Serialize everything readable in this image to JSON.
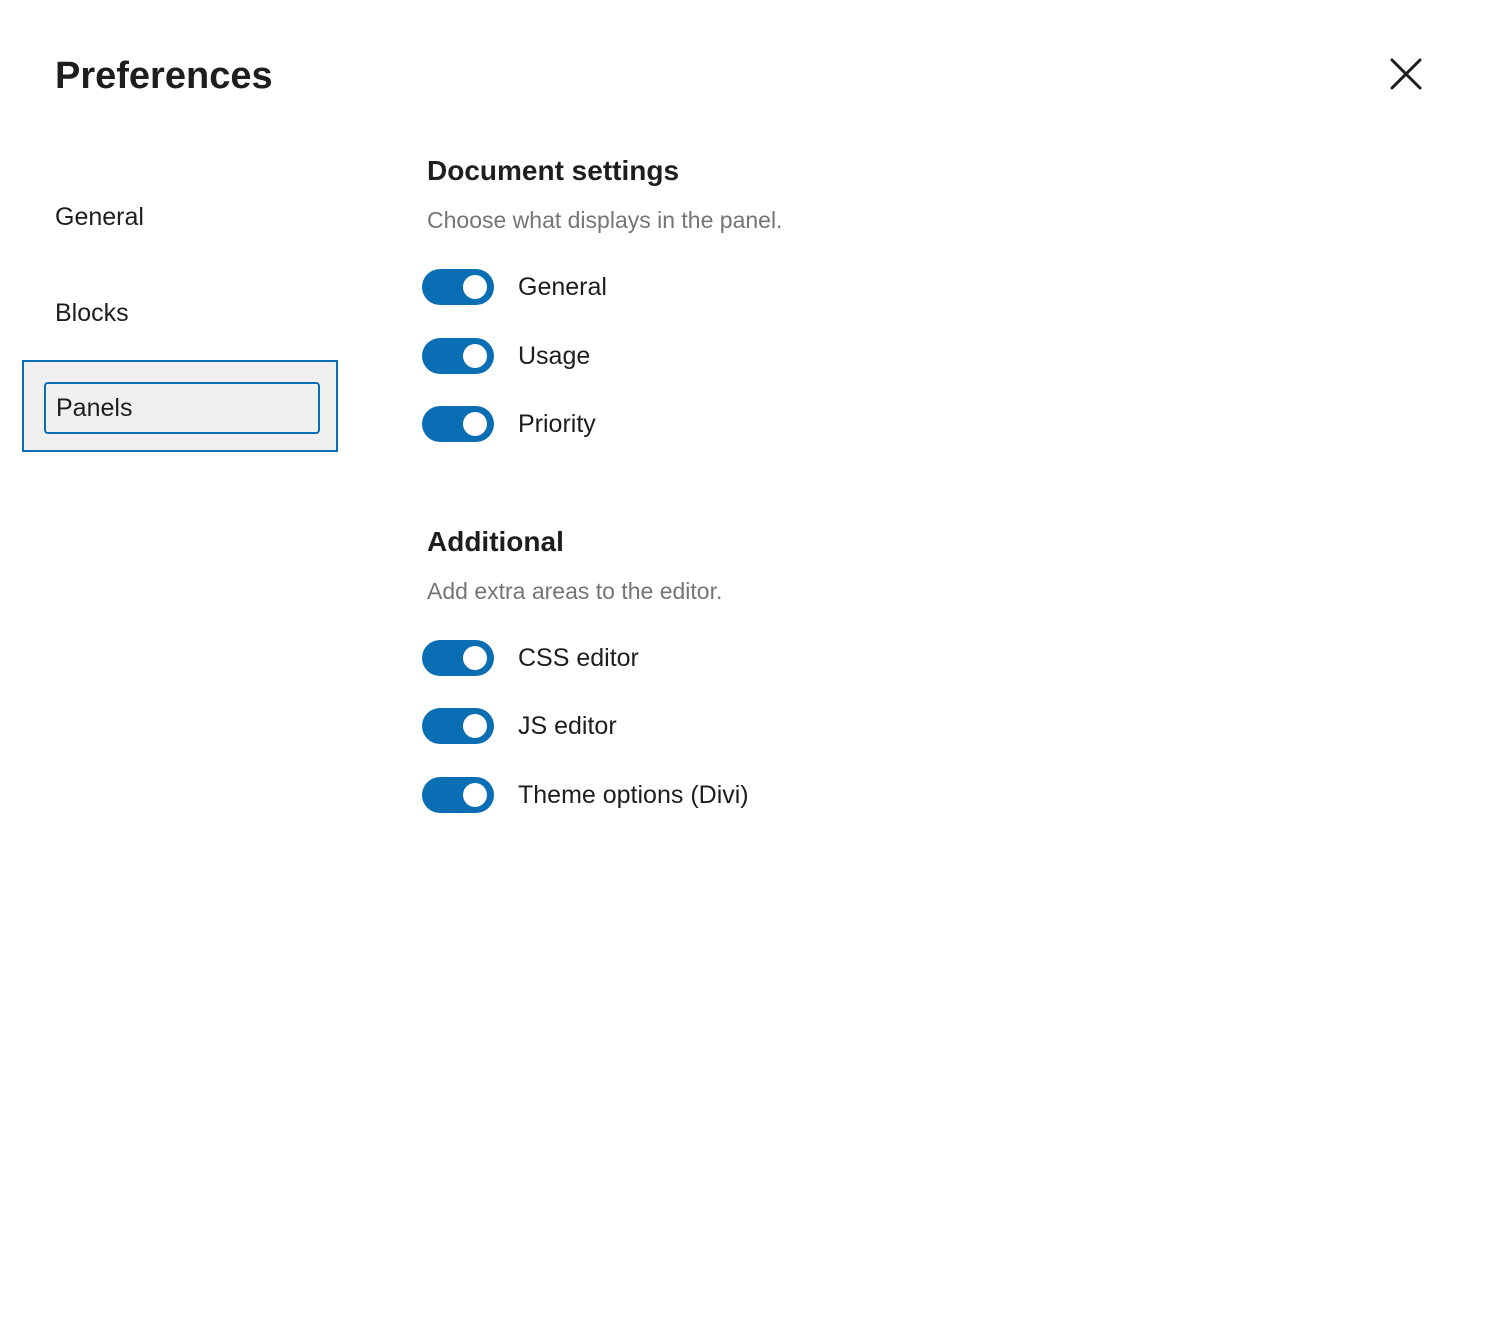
{
  "modal": {
    "title": "Preferences",
    "close_icon": "close-icon"
  },
  "sidebar": {
    "items": [
      {
        "label": "General",
        "active": false
      },
      {
        "label": "Blocks",
        "active": false
      },
      {
        "label": "Panels",
        "active": true
      }
    ]
  },
  "content": {
    "sections": [
      {
        "title": "Document settings",
        "description": "Choose what displays in the panel.",
        "toggles": [
          {
            "label": "General",
            "checked": true
          },
          {
            "label": "Usage",
            "checked": true
          },
          {
            "label": "Priority",
            "checked": true
          }
        ]
      },
      {
        "title": "Additional",
        "description": "Add extra areas to the editor.",
        "toggles": [
          {
            "label": "CSS editor",
            "checked": true
          },
          {
            "label": "JS editor",
            "checked": true
          },
          {
            "label": "Theme options (Divi)",
            "checked": true
          }
        ]
      }
    ]
  },
  "colors": {
    "accent": "#0a6eb4",
    "text": "#1e1e1e",
    "muted_text": "#757575",
    "active_nav_bg": "#f0f0f0"
  }
}
